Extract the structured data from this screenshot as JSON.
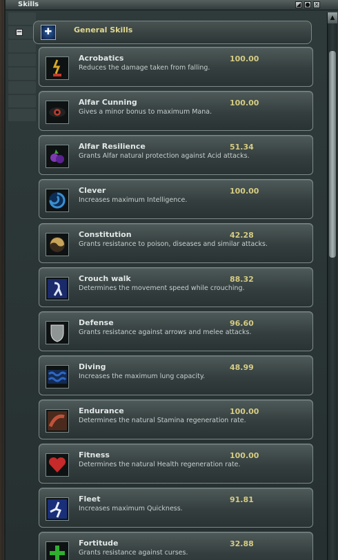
{
  "window": {
    "title": "Skills",
    "buttons": [
      {
        "name": "resize-button",
        "glyph": "◢"
      },
      {
        "name": "minimize-button",
        "glyph": "●"
      },
      {
        "name": "close-button",
        "glyph": "✕"
      }
    ]
  },
  "group": {
    "collapse_glyph": "−",
    "icon_glyph": "✚",
    "label": "General Skills"
  },
  "scroll": {
    "up_glyph": "▲"
  },
  "skills": [
    {
      "name": "Acrobatics",
      "desc": "Reduces the damage taken from falling.",
      "value": "100.00",
      "icon": "acrobatics-icon",
      "color": "#d6a82a"
    },
    {
      "name": "Alfar Cunning",
      "desc": "Gives a minor bonus to maximum Mana.",
      "value": "100.00",
      "icon": "alfar-cunning-icon",
      "color": "#b23a2e"
    },
    {
      "name": "Alfar Resilience",
      "desc": "Grants Alfar natural protection against Acid attacks.",
      "value": "51.34",
      "icon": "alfar-resilience-icon",
      "color": "#7c3ab0"
    },
    {
      "name": "Clever",
      "desc": "Increases maximum Intelligence.",
      "value": "100.00",
      "icon": "clever-icon",
      "color": "#3a8fd0"
    },
    {
      "name": "Constitution",
      "desc": "Grants resistance to poison, diseases and similar attacks.",
      "value": "42.28",
      "icon": "constitution-icon",
      "color": "#c7a45a"
    },
    {
      "name": "Crouch walk",
      "desc": "Determines the movement speed while crouching.",
      "value": "88.32",
      "icon": "crouch-walk-icon",
      "color": "#3b4fb8"
    },
    {
      "name": "Defense",
      "desc": "Grants resistance against arrows and melee attacks.",
      "value": "96.60",
      "icon": "defense-icon",
      "color": "#8f9595"
    },
    {
      "name": "Diving",
      "desc": "Increases the maximum lung capacity.",
      "value": "48.99",
      "icon": "diving-icon",
      "color": "#2f66c2"
    },
    {
      "name": "Endurance",
      "desc": "Determines the natural Stamina regeneration rate.",
      "value": "100.00",
      "icon": "endurance-icon",
      "color": "#c0523a"
    },
    {
      "name": "Fitness",
      "desc": "Determines the natural Health regeneration rate.",
      "value": "100.00",
      "icon": "fitness-icon",
      "color": "#c72a2a"
    },
    {
      "name": "Fleet",
      "desc": "Increases maximum Quickness.",
      "value": "91.81",
      "icon": "fleet-icon",
      "color": "#3d6fd0"
    },
    {
      "name": "Fortitude",
      "desc": "Grants resistance against curses.",
      "value": "32.88",
      "icon": "fortitude-icon",
      "color": "#2fb02f"
    }
  ]
}
